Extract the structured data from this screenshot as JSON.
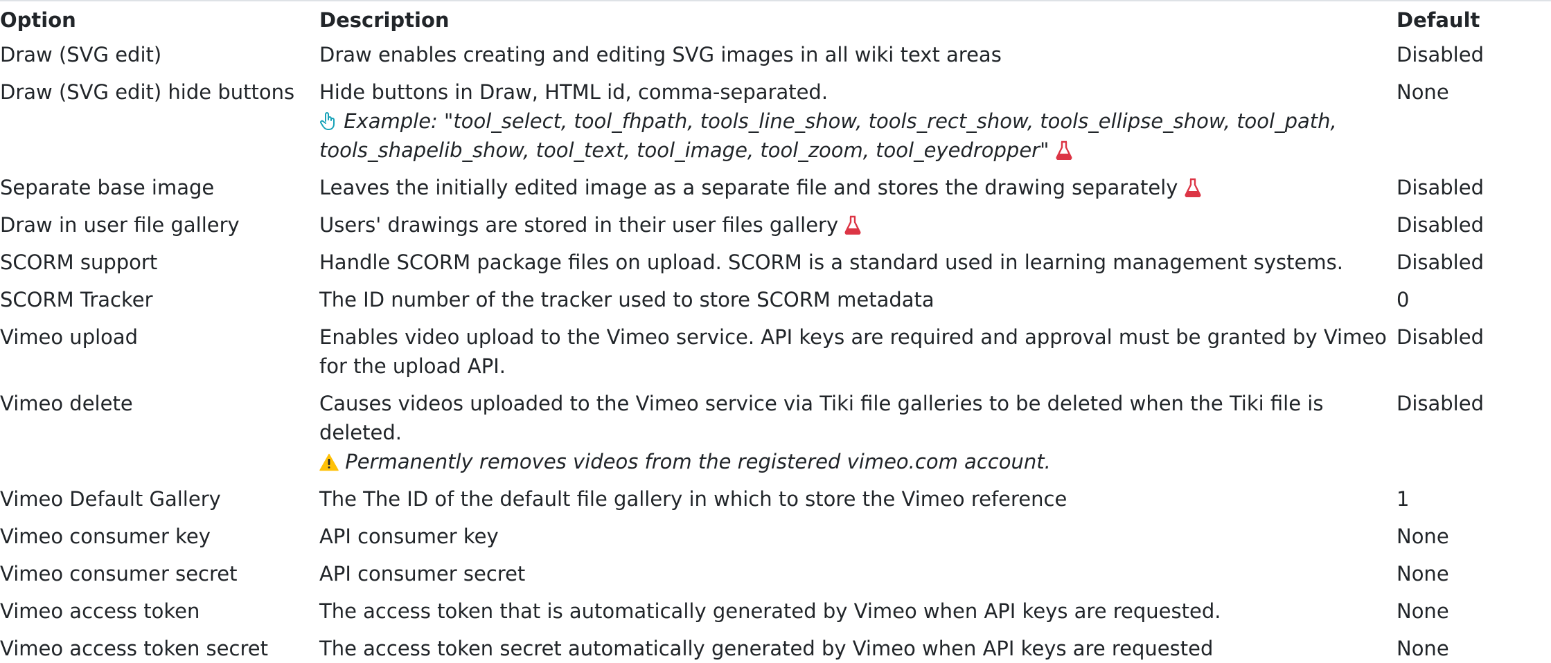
{
  "headers": {
    "option": "Option",
    "description": "Description",
    "default": "Default"
  },
  "rows": [
    {
      "option": "Draw (SVG edit)",
      "description": "Draw enables creating and editing SVG images in all wiki text areas",
      "default": "Disabled"
    },
    {
      "option": "Draw (SVG edit) hide buttons",
      "description": "Hide buttons in Draw, HTML id, comma-separated.",
      "example_label": "Example: \"",
      "example_value": "tool_select, tool_fhpath, tools_line_show, tools_rect_show, tools_ellipse_show, tool_path, tools_shapelib_show, tool_text, tool_image, tool_zoom, tool_eyedropper",
      "example_end": "\"",
      "default": "None"
    },
    {
      "option": "Separate base image",
      "description": "Leaves the initially edited image as a separate file and stores the drawing separately",
      "default": "Disabled"
    },
    {
      "option": "Draw in user file gallery",
      "description": "Users' drawings are stored in their user files gallery",
      "default": "Disabled"
    },
    {
      "option": "SCORM support",
      "description": "Handle SCORM package files on upload. SCORM is a standard used in learning management systems.",
      "default": "Disabled"
    },
    {
      "option": "SCORM Tracker",
      "description": "The ID number of the tracker used to store SCORM metadata",
      "default": "0"
    },
    {
      "option": "Vimeo upload",
      "description": "Enables video upload to the Vimeo service. API keys are required and approval must be granted by Vimeo for the upload API.",
      "default": "Disabled"
    },
    {
      "option": "Vimeo delete",
      "description": "Causes videos uploaded to the Vimeo service via Tiki file galleries to be deleted when the Tiki file is deleted.",
      "warning": "Permanently removes videos from the registered vimeo.com account.",
      "default": "Disabled"
    },
    {
      "option": "Vimeo Default Gallery",
      "description": "The The ID of the default file gallery in which to store the Vimeo reference",
      "default": "1"
    },
    {
      "option": "Vimeo consumer key",
      "description": "API consumer key",
      "default": "None"
    },
    {
      "option": "Vimeo consumer secret",
      "description": "API consumer secret",
      "default": "None"
    },
    {
      "option": "Vimeo access token",
      "description": "The access token that is automatically generated by Vimeo when API keys are requested.",
      "default": "None"
    },
    {
      "option": "Vimeo access token secret",
      "description": "The access token secret automatically generated by Vimeo when API keys are requested",
      "default": "None"
    }
  ],
  "icons": {
    "experimental": "flask-icon",
    "hint": "pointing-hand-icon",
    "warning": "warning-triangle-icon",
    "experimental_color": "#dc3545",
    "hint_color": "#17a2b8",
    "warning_color": "#ffc107"
  }
}
